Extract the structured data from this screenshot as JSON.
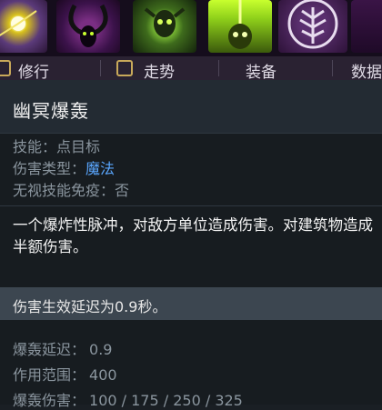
{
  "ability_icons": [
    {
      "name": "malefice-icon"
    },
    {
      "name": "demonic-conversion-icon"
    },
    {
      "name": "midnight-pulse-icon"
    },
    {
      "name": "black-hole-icon"
    },
    {
      "name": "talent-tree-icon"
    },
    {
      "name": "extra-ability-icon"
    }
  ],
  "tabs": [
    {
      "label": "修行"
    },
    {
      "label": "走势"
    },
    {
      "label": "装备"
    },
    {
      "label": "数据"
    }
  ],
  "ability": {
    "title": "幽冥爆轰",
    "meta": [
      {
        "key": "技能：",
        "value": "点目标",
        "style": "plain"
      },
      {
        "key": "伤害类型：",
        "value": "魔法",
        "style": "magic"
      },
      {
        "key": "无视技能免疫：",
        "value": "否",
        "style": "plain"
      }
    ],
    "description": "一个爆炸性脉冲，对敌方单位造成伤害。对建筑物造成半额伤害。",
    "note": "伤害生效延迟为0.9秒。",
    "stats": [
      {
        "key": "爆轰延迟：",
        "value": "0.9"
      },
      {
        "key": "作用范围：",
        "value": "400"
      },
      {
        "key": "爆轰伤害：",
        "value": "100 / 175 / 250 / 325"
      }
    ]
  },
  "colors": {
    "magic_damage": "#5aa7ff",
    "label_gray": "#8a959e",
    "title_bar": "#232b33",
    "note_bar": "#3c4650"
  }
}
